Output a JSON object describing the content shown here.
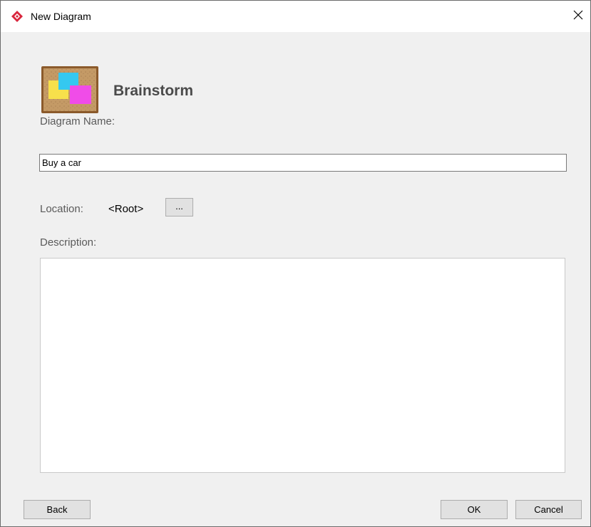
{
  "window": {
    "title": "New Diagram",
    "close_glyph": "✕"
  },
  "diagram": {
    "type_name": "Brainstorm",
    "icon": "brainstorm-board-icon"
  },
  "form": {
    "name_label": "Diagram Name:",
    "name_value": "Buy a car",
    "location_label": "Location:",
    "location_value": "<Root>",
    "browse_label": "...",
    "description_label": "Description:",
    "description_value": ""
  },
  "footer": {
    "back_label": "Back",
    "ok_label": "OK",
    "cancel_label": "Cancel"
  },
  "colors": {
    "app_icon": "#d9263d",
    "board_frame": "#8b5a2b",
    "board_cork": "#c49a66",
    "note_cyan": "#35c8f0",
    "note_yellow": "#f7e04b",
    "note_magenta": "#f04ce8"
  }
}
